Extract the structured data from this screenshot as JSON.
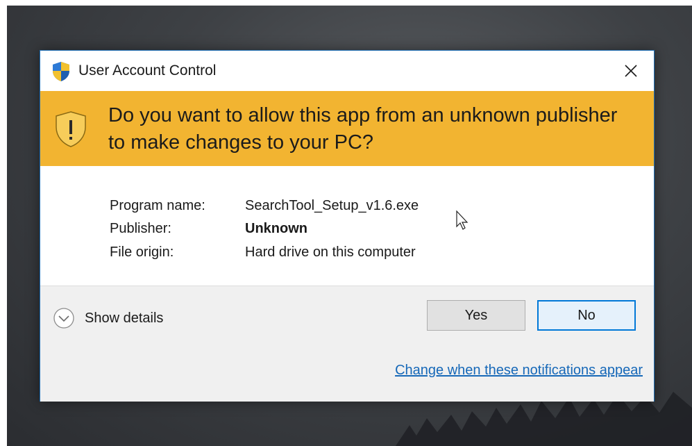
{
  "dialog": {
    "title": "User Account Control",
    "question": "Do you want to allow this app from an unknown publisher to make changes to your PC?",
    "fields": [
      {
        "label": "Program name:",
        "value": "SearchTool_Setup_v1.6.exe"
      },
      {
        "label": "Publisher:",
        "value": "Unknown"
      },
      {
        "label": "File origin:",
        "value": "Hard drive on this computer"
      }
    ],
    "show_details_label": "Show details",
    "yes_label": "Yes",
    "no_label": "No",
    "change_link": "Change when these notifications appear",
    "icons": {
      "title_icon": "uac-shield-icon",
      "banner_icon": "warning-shield-icon",
      "close_icon": "close-icon",
      "details_icon": "chevron-down-icon"
    },
    "colors": {
      "banner": "#f2b431",
      "accent": "#0078d7",
      "link": "#1668b8"
    }
  }
}
